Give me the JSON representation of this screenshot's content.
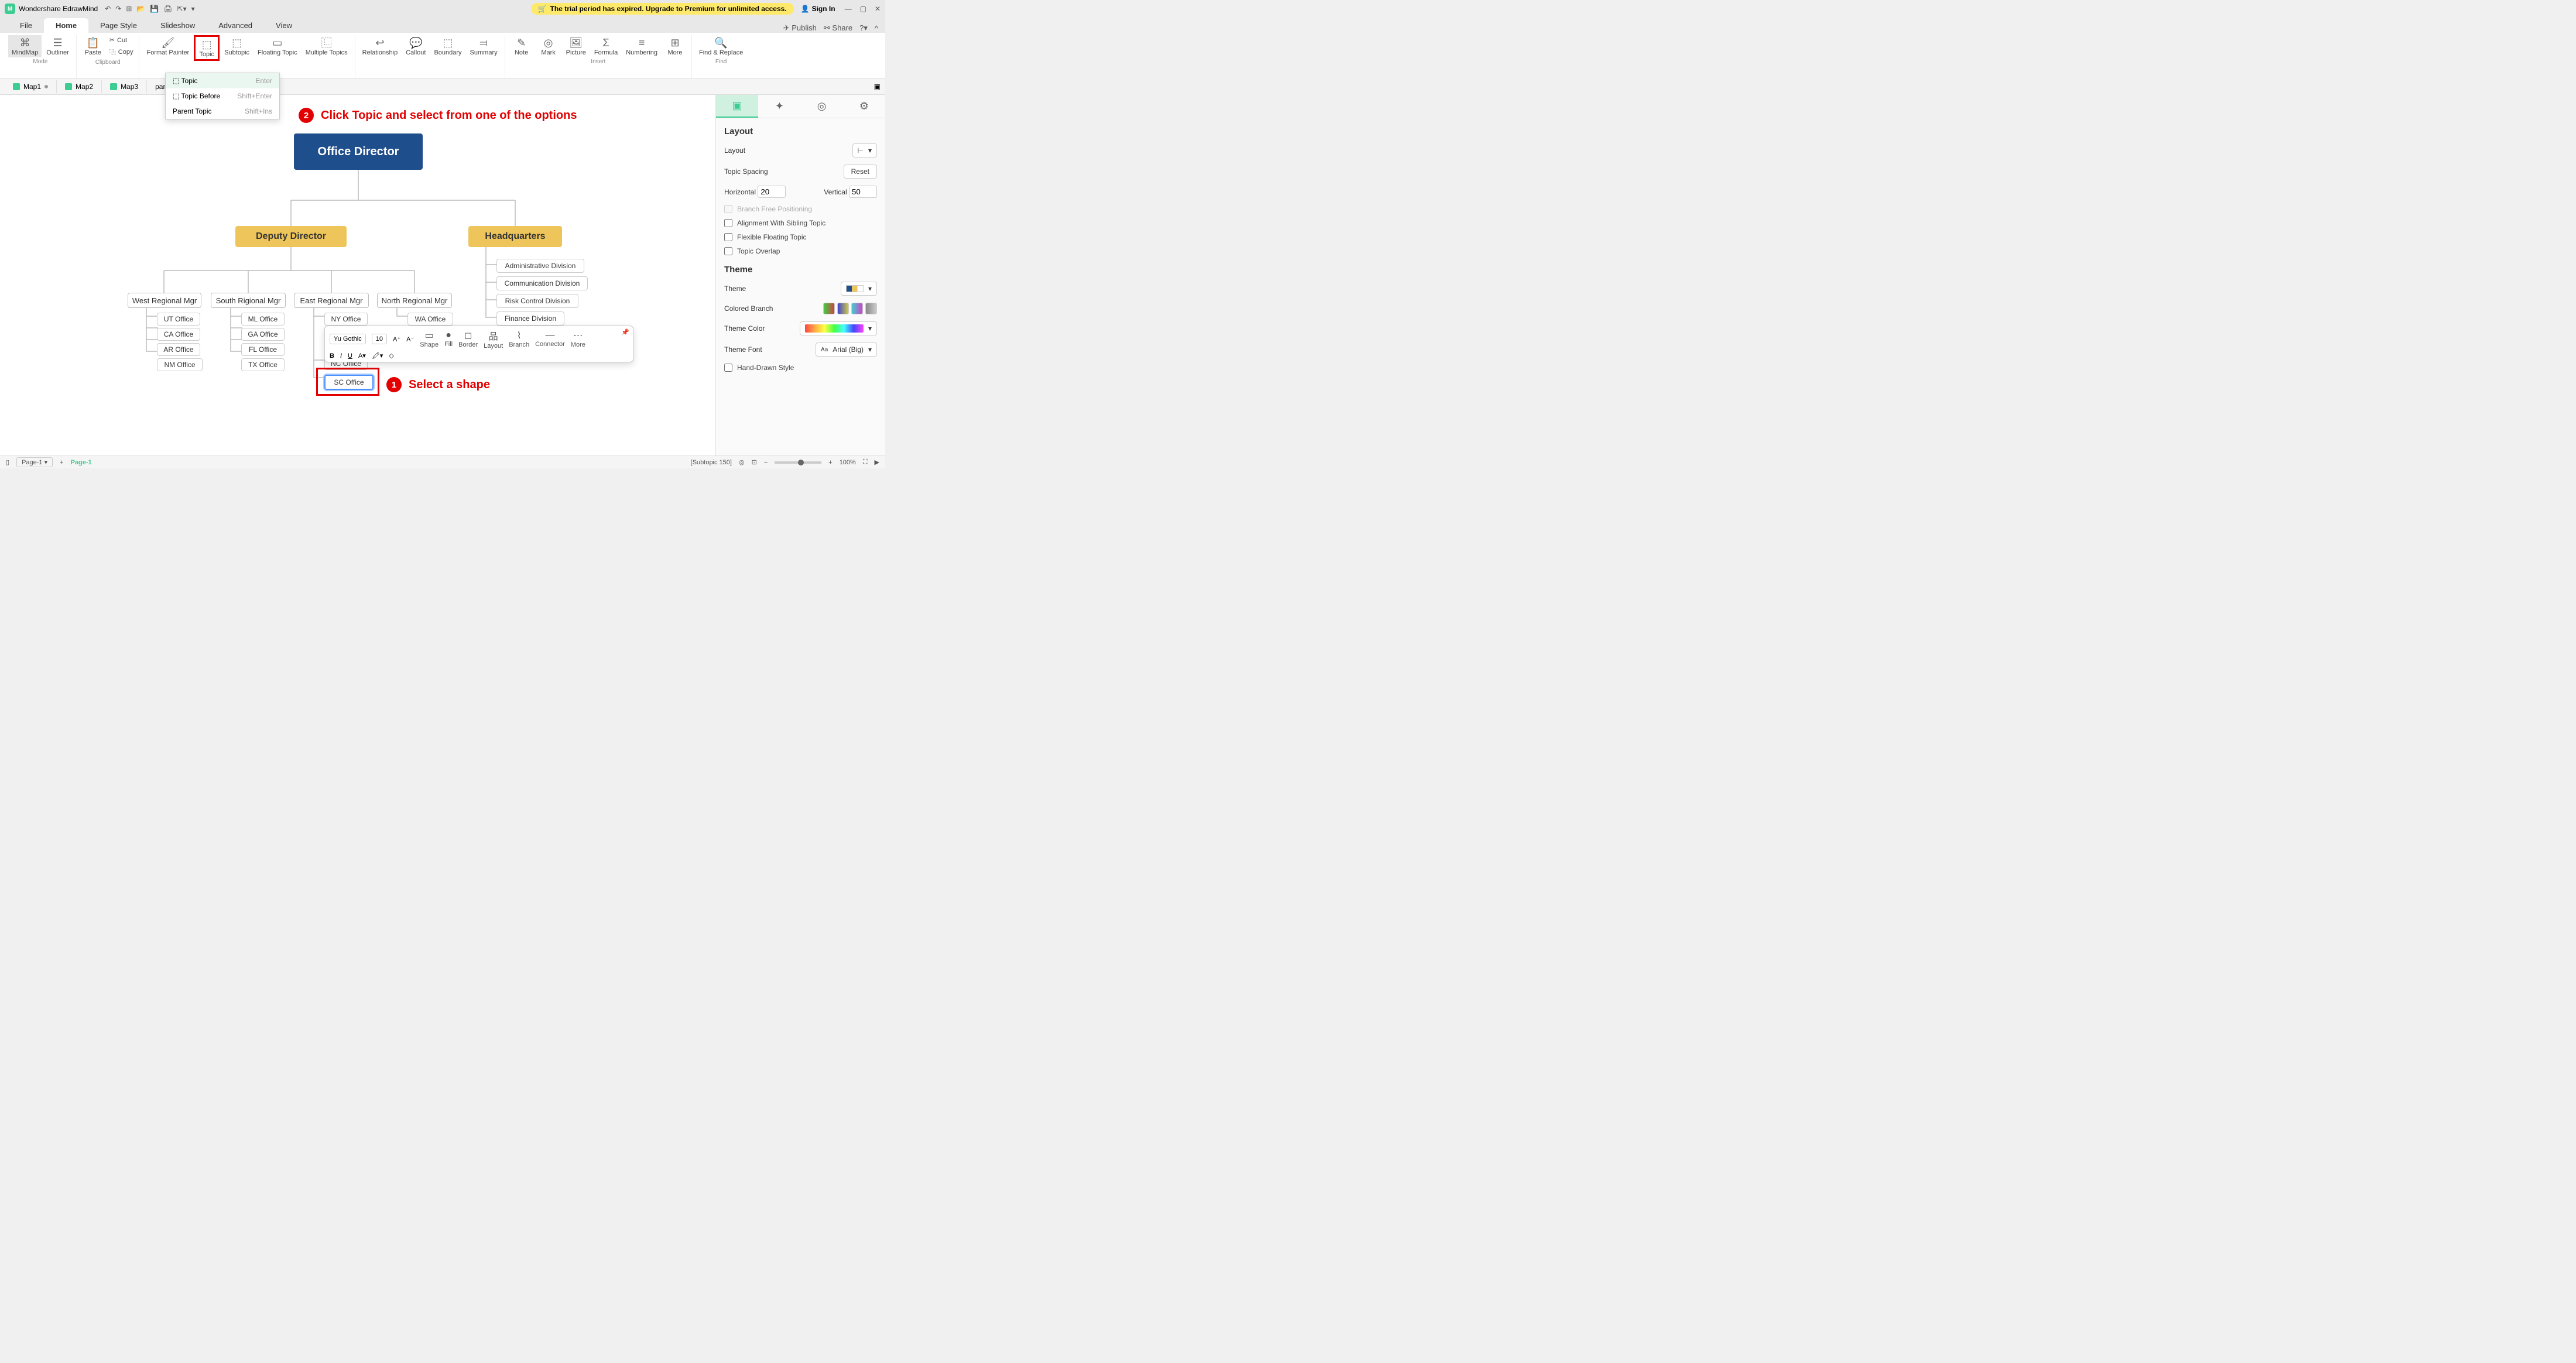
{
  "app": {
    "title": "Wondershare EdrawMind"
  },
  "titlebar": {
    "trial": "The trial period has expired. Upgrade to Premium for unlimited access.",
    "signin": "Sign In"
  },
  "menutabs": {
    "file": "File",
    "home": "Home",
    "pagestyle": "Page Style",
    "slideshow": "Slideshow",
    "advanced": "Advanced",
    "view": "View",
    "publish": "Publish",
    "share": "Share"
  },
  "ribbon": {
    "mode": "Mode",
    "mindmap": "MindMap",
    "outliner": "Outliner",
    "clipboard": "Clipboard",
    "paste": "Paste",
    "cut": "Cut",
    "copy": "Copy",
    "formatpainter": "Format Painter",
    "topic": "Topic",
    "subtopic": "Subtopic",
    "floatingtopic": "Floating Topic",
    "multipletopics": "Multiple Topics",
    "relationship": "Relationship",
    "callout": "Callout",
    "boundary": "Boundary",
    "summary": "Summary",
    "insert": "Insert",
    "note": "Note",
    "mark": "Mark",
    "picture": "Picture",
    "formula": "Formula",
    "numbering": "Numbering",
    "more": "More",
    "findreplace": "Find & Replace",
    "find": "Find"
  },
  "dropdown": {
    "topic": "Topic",
    "topic_sc": "Enter",
    "topicbefore": "Topic Before",
    "topicbefore_sc": "Shift+Enter",
    "parenttopic": "Parent Topic",
    "parenttopic_sc": "Shift+Ins"
  },
  "doctabs": {
    "map1": "Map1",
    "map2": "Map2",
    "map3": "Map3",
    "cs": "pany Structure"
  },
  "chart_data": {
    "type": "tree",
    "root": "Office Director",
    "children": [
      {
        "name": "Deputy Director",
        "children": [
          {
            "name": "West Regional Mgr",
            "children": [
              "UT Office",
              "CA Office",
              "AR Office",
              "NM Office"
            ]
          },
          {
            "name": "South Rigional Mgr",
            "children": [
              "ML Office",
              "GA Office",
              "FL Office",
              "TX Office"
            ]
          },
          {
            "name": "East Regional Mgr",
            "children": [
              "NY Office",
              "NC Office",
              "SC Office"
            ]
          },
          {
            "name": "North Regional Mgr",
            "children": [
              "WA Office"
            ]
          }
        ]
      },
      {
        "name": "Headquarters",
        "children": [
          "Administrative Division",
          "Communication Division",
          "Risk Control Division",
          "Finance Division"
        ]
      }
    ]
  },
  "nodes": {
    "root": "Office Director",
    "deputy": "Deputy Director",
    "hq": "Headquarters",
    "west": "West Regional Mgr",
    "south": "South Rigional Mgr",
    "east": "East Regional Mgr",
    "north": "North Regional Mgr",
    "ut": "UT Office",
    "ca": "CA Office",
    "ar": "AR Office",
    "nm": "NM Office",
    "ml": "ML Office",
    "ga": "GA Office",
    "fl": "FL Office",
    "tx": "TX Office",
    "ny": "NY Office",
    "nc": "NC Office",
    "sc": "SC Office",
    "wa": "WA Office",
    "admin": "Administrative Division",
    "comm": "Communication Division",
    "risk": "Risk Control Division",
    "fin": "Finance Division"
  },
  "minitb": {
    "font": "Yu Gothic",
    "size": "10",
    "shape": "Shape",
    "fill": "Fill",
    "border": "Border",
    "layout": "Layout",
    "branch": "Branch",
    "connector": "Connector",
    "more": "More"
  },
  "panel": {
    "layout_h": "Layout",
    "layout": "Layout",
    "spacing": "Topic Spacing",
    "reset": "Reset",
    "horizontal": "Horizontal",
    "hval": "20",
    "vertical": "Vertical",
    "vval": "50",
    "branchfree": "Branch Free Positioning",
    "alignsib": "Alignment With Sibling Topic",
    "flexfloat": "Flexible Floating Topic",
    "overlap": "Topic Overlap",
    "theme_h": "Theme",
    "theme": "Theme",
    "coloredbranch": "Colored Branch",
    "themecolor": "Theme Color",
    "themefont": "Theme Font",
    "themefont_v": "Arial (Big)",
    "handdrawn": "Hand-Drawn Style"
  },
  "anno": {
    "step1": "Select a shape",
    "step2": "Click Topic and select from one of the options"
  },
  "status": {
    "page": "Page-1",
    "activepage": "Page-1",
    "subtopic": "[Subtopic 150]",
    "zoom": "100%"
  }
}
